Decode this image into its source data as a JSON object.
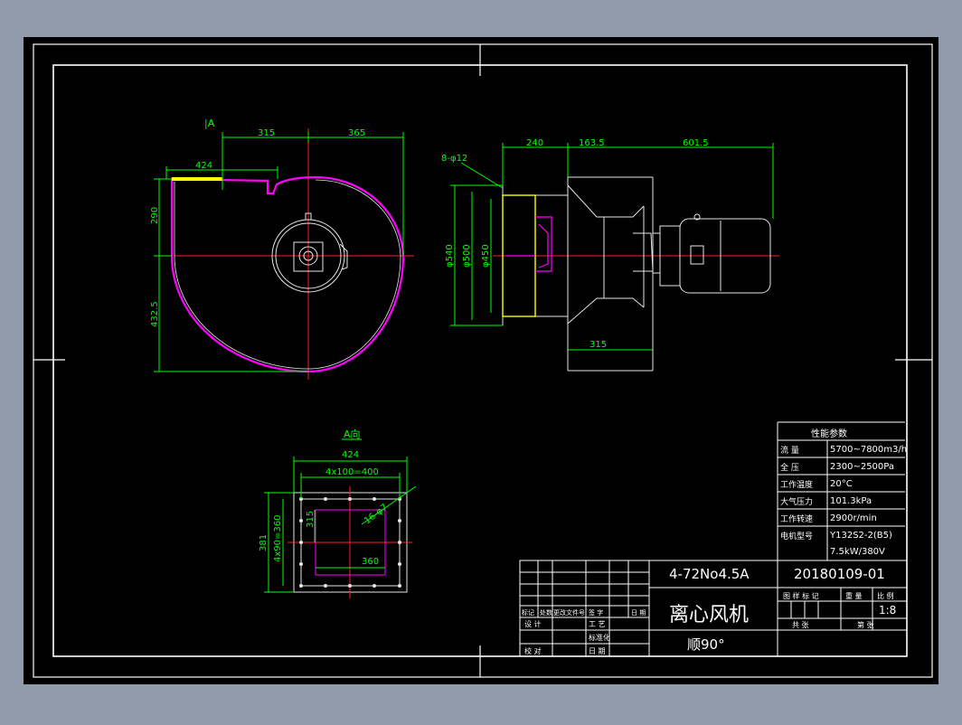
{
  "colors": {
    "window_bg": "#8f9aab",
    "canvas_bg": "#000000",
    "frame": "#ffffff",
    "dimension": "#00ff00",
    "centerline": "#ff2020",
    "outline_magenta": "#ff00ff",
    "yellow": "#ffff00",
    "body": "#e6e6e6",
    "text": "#ffffff"
  },
  "view_a_marker": "|A",
  "front_view": {
    "dims": {
      "d315": "315",
      "d365": "365",
      "d424": "424",
      "d290": "290",
      "d4325": "432.5"
    }
  },
  "side_view": {
    "dims": {
      "d240": "240",
      "d1635": "163.5",
      "d6015": "601.5",
      "holes": "8-φ12",
      "d540": "φ540",
      "d500": "φ500",
      "d450": "φ450",
      "d315": "315"
    }
  },
  "section_a": {
    "title": "A向",
    "dims": {
      "d424": "424",
      "d4x100": "4x100=400",
      "d381": "381",
      "d4x90": "4x90=360",
      "d315": "315",
      "d360": "360",
      "holes": "16-φ7"
    }
  },
  "performance_table": {
    "title": "性能参数",
    "rows": [
      {
        "label": "流   量",
        "value": "5700~7800m3/h"
      },
      {
        "label": "全   压",
        "value": "2300~2500Pa"
      },
      {
        "label": "工作温度",
        "value": "20°C"
      },
      {
        "label": "大气压力",
        "value": "101.3kPa"
      },
      {
        "label": "工作转速",
        "value": "2900r/min"
      },
      {
        "label": "电机型号",
        "value": "Y132S2-2(B5)"
      },
      {
        "label": "",
        "value": "7.5kW/380V"
      }
    ]
  },
  "title_block": {
    "model": "4-72No4.5A",
    "drawing_no": "20180109-01",
    "name": "离心风机",
    "rotation": "顺90°",
    "stage_mark": "图 样 标 记",
    "weight": "重 量",
    "scale_label": "比 例",
    "scale": "1:8",
    "total_sheets": "共    张",
    "sheet": "第    张",
    "rev_headers": [
      "标记",
      "处数",
      "更改文件号",
      "签 字",
      "日 期"
    ],
    "design": "设  计",
    "craft": "工  艺",
    "check": "校  对",
    "review": "审  核",
    "standard": "标准化",
    "date": "日 期"
  }
}
